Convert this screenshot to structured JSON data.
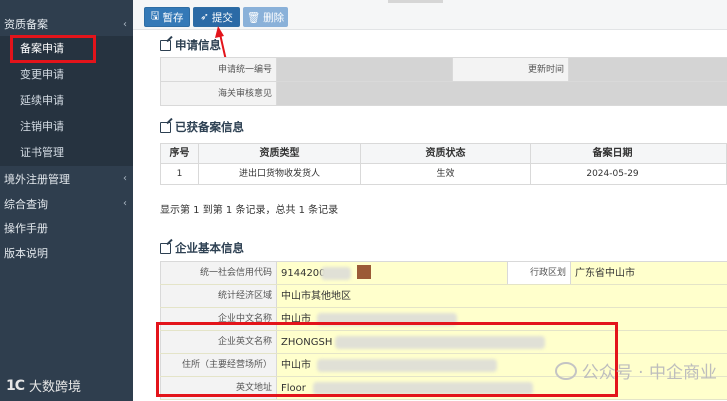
{
  "sidebar": {
    "group_qual": "资质备案",
    "sub_items": [
      "备案申请",
      "变更申请",
      "延续申请",
      "注销申请",
      "证书管理"
    ],
    "group_overseas": "境外注册管理",
    "group_query": "综合查询",
    "manual": "操作手册",
    "version": "版本说明",
    "logo_mark": "1C",
    "logo_text": "大数跨境"
  },
  "toolbar": {
    "save_label": "暂存",
    "submit_label": "提交",
    "delete_label": "删除"
  },
  "apply_info": {
    "title": "申请信息",
    "unified_no_label": "申请统一编号",
    "update_time_label": "更新时间",
    "customs_opinion_label": "海关审核意见"
  },
  "filed_info": {
    "title": "已获备案信息",
    "headers": [
      "序号",
      "资质类型",
      "资质状态",
      "备案日期"
    ],
    "rows": [
      {
        "no": "1",
        "type": "进出口货物收发货人",
        "status": "生效",
        "date": "2024-05-29"
      }
    ],
    "footer": "显示第 1 到第 1 条记录，总共 1 条记录"
  },
  "company_info": {
    "title": "企业基本信息",
    "credit_code_label": "统一社会信用代码",
    "credit_code_value": "9144200",
    "region_label": "行政区划",
    "region_value": "广东省中山市",
    "econ_zone_label": "统计经济区域",
    "econ_zone_value": "中山市其他地区",
    "cn_name_label": "企业中文名称",
    "cn_name_value": "中山市",
    "en_name_label": "企业英文名称",
    "en_name_value": "ZHONGSH",
    "address_label": "住所（主要经营场所）",
    "address_value": "中山市",
    "en_address_label": "英文地址",
    "en_address_value": "Floor"
  },
  "watermark": "公众号 · 中企商业",
  "colors": {
    "highlight": "#e3141b",
    "primary": "#3479b7",
    "sidebar": "#2f3e4e",
    "field_yellow": "#ffffcc"
  }
}
